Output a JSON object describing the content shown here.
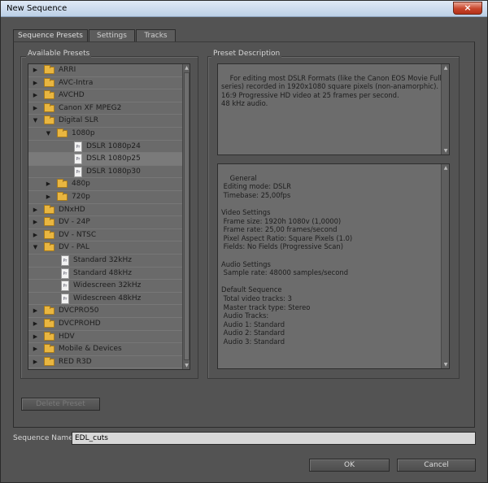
{
  "window": {
    "title": "New Sequence",
    "close_glyph": "×",
    "close_icon": "close-icon"
  },
  "tabs": [
    {
      "label": "Sequence Presets",
      "active": true
    },
    {
      "label": "Settings",
      "active": false
    },
    {
      "label": "Tracks",
      "active": false
    }
  ],
  "available_presets": {
    "label": "Available Presets",
    "items": [
      {
        "label": "ARRI",
        "type": "folder",
        "expanded": false,
        "level": 0
      },
      {
        "label": "AVC-Intra",
        "type": "folder",
        "expanded": false,
        "level": 0
      },
      {
        "label": "AVCHD",
        "type": "folder",
        "expanded": false,
        "level": 0
      },
      {
        "label": "Canon XF MPEG2",
        "type": "folder",
        "expanded": false,
        "level": 0
      },
      {
        "label": "Digital SLR",
        "type": "folder",
        "expanded": true,
        "level": 0
      },
      {
        "label": "1080p",
        "type": "folder",
        "expanded": true,
        "level": 1
      },
      {
        "label": "DSLR 1080p24",
        "type": "preset",
        "level": 2
      },
      {
        "label": "DSLR 1080p25",
        "type": "preset",
        "level": 2,
        "selected": true
      },
      {
        "label": "DSLR 1080p30",
        "type": "preset",
        "level": 2
      },
      {
        "label": "480p",
        "type": "folder",
        "expanded": false,
        "level": 1
      },
      {
        "label": "720p",
        "type": "folder",
        "expanded": false,
        "level": 1
      },
      {
        "label": "DNxHD",
        "type": "folder",
        "expanded": false,
        "level": 0
      },
      {
        "label": "DV - 24P",
        "type": "folder",
        "expanded": false,
        "level": 0
      },
      {
        "label": "DV - NTSC",
        "type": "folder",
        "expanded": false,
        "level": 0
      },
      {
        "label": "DV - PAL",
        "type": "folder",
        "expanded": true,
        "level": 0
      },
      {
        "label": "Standard 32kHz",
        "type": "preset",
        "level": 1
      },
      {
        "label": "Standard 48kHz",
        "type": "preset",
        "level": 1
      },
      {
        "label": "Widescreen 32kHz",
        "type": "preset",
        "level": 1
      },
      {
        "label": "Widescreen 48kHz",
        "type": "preset",
        "level": 1
      },
      {
        "label": "DVCPRO50",
        "type": "folder",
        "expanded": false,
        "level": 0
      },
      {
        "label": "DVCPROHD",
        "type": "folder",
        "expanded": false,
        "level": 0
      },
      {
        "label": "HDV",
        "type": "folder",
        "expanded": false,
        "level": 0
      },
      {
        "label": "Mobile & Devices",
        "type": "folder",
        "expanded": false,
        "level": 0
      },
      {
        "label": "RED R3D",
        "type": "folder",
        "expanded": false,
        "level": 0
      }
    ]
  },
  "preset_description": {
    "label": "Preset Description",
    "description": "For editing most DSLR Formats (like the Canon EOS Movie Full HD\nseries) recorded in 1920x1080 square pixels (non-anamorphic).\n16:9 Progressive HD video at 25 frames per second.\n48 kHz audio.",
    "details": "General\n Editing mode: DSLR\n Timebase: 25,00fps\n\nVideo Settings\n Frame size: 1920h 1080v (1,0000)\n Frame rate: 25,00 frames/second\n Pixel Aspect Ratio: Square Pixels (1.0)\n Fields: No Fields (Progressive Scan)\n\nAudio Settings\n Sample rate: 48000 samples/second\n\nDefault Sequence\n Total video tracks: 3\n Master track type: Stereo\n Audio Tracks:\n Audio 1: Standard\n Audio 2: Standard\n Audio 3: Standard"
  },
  "buttons": {
    "delete_preset": "Delete Preset",
    "ok": "OK",
    "cancel": "Cancel"
  },
  "sequence_name": {
    "label": "Sequence Name:",
    "value": "EDL_cuts"
  },
  "glyphs": {
    "collapsed": "▶",
    "expanded": "▼",
    "scroll_up": "▲",
    "scroll_down": "▼",
    "preset_file": "Pr"
  }
}
